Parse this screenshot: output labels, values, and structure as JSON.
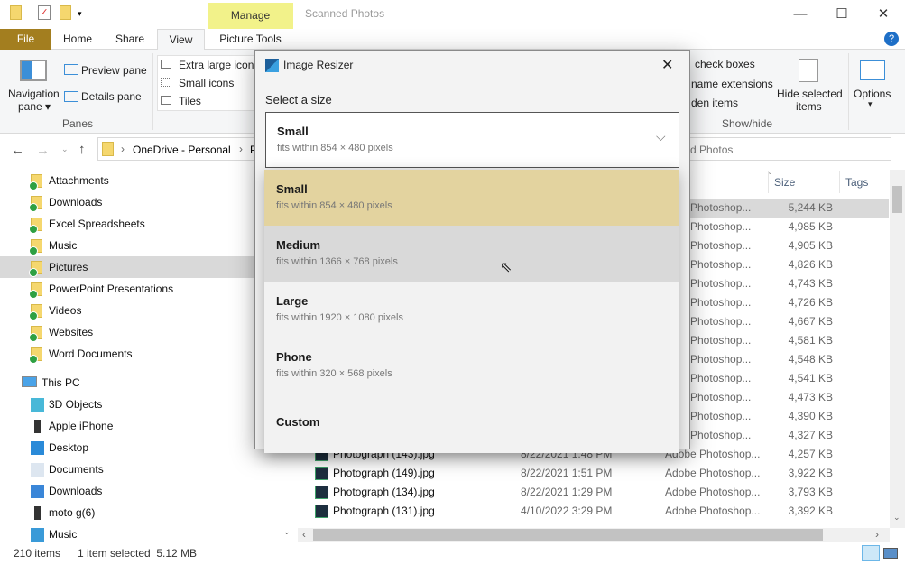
{
  "window": {
    "title": "Scanned Photos",
    "context_tab": "Manage",
    "minimize": "—",
    "maximize": "☐",
    "close": "✕",
    "help": "?"
  },
  "tabs": [
    {
      "label": "File"
    },
    {
      "label": "Home"
    },
    {
      "label": "Share"
    },
    {
      "label": "View"
    },
    {
      "label": "Picture Tools"
    }
  ],
  "ribbon": {
    "nav_pane": "Navigation",
    "nav_pane2": "pane ▾",
    "preview_pane": "Preview pane",
    "details_pane": "Details pane",
    "panes_group": "Panes",
    "layout": [
      "Extra large icons",
      "Small icons",
      "Tiles"
    ],
    "showhide": [
      "check boxes",
      "name extensions",
      "den items"
    ],
    "hide_selected": "Hide selected",
    "hide_selected2": "items",
    "showhide_group": "Show/hide",
    "options": "Options",
    "options_arrow": "▾"
  },
  "address": {
    "crumbs": [
      "OneDrive - Personal",
      "P"
    ],
    "search_fragment": "d Photos"
  },
  "sidebar": {
    "onedrive_items": [
      "Attachments",
      "Downloads",
      "Excel Spreadsheets",
      "Music",
      "Pictures",
      "PowerPoint Presentations",
      "Videos",
      "Websites",
      "Word Documents"
    ],
    "selected": "Pictures",
    "this_pc": "This PC",
    "pc_items": [
      {
        "label": "3D Objects",
        "icon": "3d-objects-icon"
      },
      {
        "label": "Apple iPhone",
        "icon": "phone-icon"
      },
      {
        "label": "Desktop",
        "icon": "desktop-icon"
      },
      {
        "label": "Documents",
        "icon": "documents-icon"
      },
      {
        "label": "Downloads",
        "icon": "download-icon"
      },
      {
        "label": "moto g(6)",
        "icon": "phone-icon"
      },
      {
        "label": "Music",
        "icon": "music-icon"
      }
    ]
  },
  "columns": {
    "size": "Size",
    "tags": "Tags"
  },
  "files": [
    {
      "type": "e Photoshop...",
      "size": "5,244 KB"
    },
    {
      "type": "e Photoshop...",
      "size": "4,985 KB"
    },
    {
      "type": "e Photoshop...",
      "size": "4,905 KB"
    },
    {
      "type": "e Photoshop...",
      "size": "4,826 KB"
    },
    {
      "type": "e Photoshop...",
      "size": "4,743 KB"
    },
    {
      "type": "e Photoshop...",
      "size": "4,726 KB"
    },
    {
      "type": "e Photoshop...",
      "size": "4,667 KB"
    },
    {
      "type": "e Photoshop...",
      "size": "4,581 KB"
    },
    {
      "type": "e Photoshop...",
      "size": "4,548 KB"
    },
    {
      "type": "e Photoshop...",
      "size": "4,541 KB"
    },
    {
      "type": "e Photoshop...",
      "size": "4,473 KB"
    },
    {
      "type": "e Photoshop...",
      "size": "4,390 KB"
    },
    {
      "type": "e Photoshop...",
      "size": "4,327 KB"
    },
    {
      "name": "Photograph (143).jpg",
      "date": "8/22/2021 1:48 PM",
      "type": "Adobe Photoshop...",
      "size": "4,257 KB"
    },
    {
      "name": "Photograph (149).jpg",
      "date": "8/22/2021 1:51 PM",
      "type": "Adobe Photoshop...",
      "size": "3,922 KB"
    },
    {
      "name": "Photograph (134).jpg",
      "date": "8/22/2021 1:29 PM",
      "type": "Adobe Photoshop...",
      "size": "3,793 KB"
    },
    {
      "name": "Photograph (131).jpg",
      "date": "4/10/2022 3:29 PM",
      "type": "Adobe Photoshop...",
      "size": "3,392 KB"
    }
  ],
  "status": {
    "count": "210 items",
    "selection": "1 item selected  5.12 MB"
  },
  "dialog": {
    "title": "Image Resizer",
    "close": "✕",
    "prompt": "Select a size",
    "selected": {
      "title": "Small",
      "desc": "fits within 854 × 480 pixels"
    },
    "options": [
      {
        "title": "Small",
        "desc": "fits within 854 × 480 pixels",
        "state": "selected"
      },
      {
        "title": "Medium",
        "desc": "fits within 1366 × 768 pixels",
        "state": "hover"
      },
      {
        "title": "Large",
        "desc": "fits within 1920 × 1080 pixels"
      },
      {
        "title": "Phone",
        "desc": "fits within 320 × 568 pixels"
      },
      {
        "title": "Custom"
      }
    ]
  },
  "colors": {
    "file_tab": "#a37e1f",
    "manage_tab": "#f2f28a",
    "option_selected": "#e3d39f",
    "option_hover": "#d9d9d9"
  }
}
